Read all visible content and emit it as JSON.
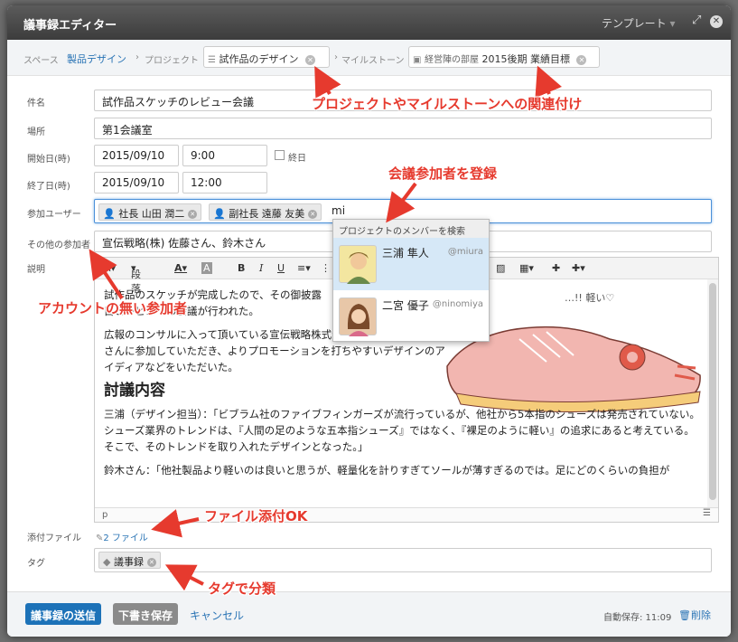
{
  "window": {
    "title": "議事録エディター",
    "template_label": "テンプレート"
  },
  "breadcrumb": {
    "space_label": "スペース",
    "space_value": "製品デザイン",
    "project_label": "プロジェクト",
    "project_value": "試作品のデザイン",
    "milestone_label": "マイルストーン",
    "milestone_group": "経営陣の部屋",
    "milestone_value": "2015後期 業績目標"
  },
  "form": {
    "subject_label": "件名",
    "subject_value": "試作品スケッチのレビュー会議",
    "place_label": "場所",
    "place_value": "第1会議室",
    "start_label": "開始日(時)",
    "start_date": "2015/09/10",
    "start_time": "9:00",
    "allday_label": "終日",
    "end_label": "終了日(時)",
    "end_date": "2015/09/10",
    "end_time": "12:00",
    "participants_label": "参加ユーザー",
    "participants": [
      "社長 山田 潤二",
      "副社長 遠藤 友美"
    ],
    "participant_query": "mi",
    "other_label": "その他の参加者",
    "other_value": "宣伝戦略(株) 佐藤さん、鈴木さん",
    "desc_label": "説明",
    "attach_label": "添付ファイル",
    "attach_value": "2 ファイル",
    "tag_label": "タグ",
    "tag_value": "議事録"
  },
  "toolbar": {
    "paragraph": "段落",
    "bold": "B",
    "italic": "I",
    "underline": "U"
  },
  "editor": {
    "p1": "試作品のスケッチが完成したので、その御披露目とレビューの会議が行われた。",
    "p2": "広報のコンサルに入って頂いている宣伝戦略株式会社から佐藤さんと鈴木さんに参加していただき、よりプロモーションを打ちやすいデザインのアイディアなどをいただいた。",
    "heading": "討議内容",
    "p3": "三浦（デザイン担当）：「ビブラム社のファイブフィンガーズが流行っているが、他社から5本指のシューズは発売されていない。シューズ業界のトレンドは、『人間の足のような五本指シューズ』ではなく、『裸足のように軽い』の追求にあると考えている。そこで、そのトレンドを取り入れたデザインとなった。」",
    "p4": "鈴木さん：「他社製品より軽いのは良いと思うが、軽量化を計りすぎてソールが薄すぎるのでは。足にどのくらいの負担が",
    "status": "p"
  },
  "dropdown": {
    "header": "プロジェクトのメンバーを検索",
    "members": [
      {
        "name": "三浦 隼人",
        "handle": "@miura"
      },
      {
        "name": "二宮 優子",
        "handle": "@ninomiya"
      }
    ]
  },
  "footer": {
    "send": "議事録の送信",
    "draft": "下書き保存",
    "cancel": "キャンセル",
    "autosave": "自動保存: 11:09",
    "delete": "削除"
  },
  "annotations": {
    "a1": "プロジェクトやマイルストーンへの関連付け",
    "a2": "会議参加者を登録",
    "a3": "アカウントの無い参加者",
    "a4": "ファイル添付OK",
    "a5": "タグで分類"
  },
  "colors": {
    "annotation": "#e63a2e",
    "primary": "#1d72b8",
    "draft": "#8a8a8a",
    "link": "#2a74b5"
  }
}
